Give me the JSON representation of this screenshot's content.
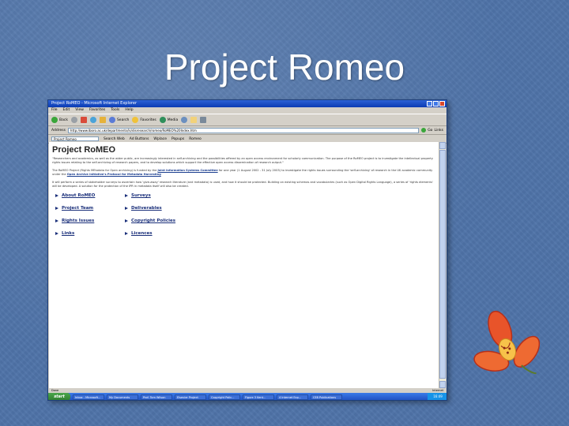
{
  "slide": {
    "title": "Project Romeo"
  },
  "browser": {
    "window_title": "Project RoMEO - Microsoft Internet Explorer",
    "menu": [
      "File",
      "Edit",
      "View",
      "Favorites",
      "Tools",
      "Help"
    ],
    "toolbar": {
      "back": "Back",
      "search": "Search",
      "favorites": "Favorites",
      "media": "Media"
    },
    "address_label": "Address",
    "address_value": "http://www.lboro.ac.uk/departments/ls/disresearch/romeo/RoMEO%20Index.htm",
    "go_label": "Go",
    "links_label": "Links",
    "search_value": "Project Romeo",
    "search_web_label": "Search Web",
    "links_bar": [
      "Ad Buttons",
      "Wplace",
      "Popups",
      "Romeo"
    ],
    "status_text": "Done",
    "status_zone": "Internet"
  },
  "page": {
    "heading": "Project RoMEO",
    "intro": "\"Researchers and academics, as well as the wider public, are increasingly interested in self-archiving and the possibilities offered by an open access environment for scholarly communication. The purpose of the RoMEO project is to investigate the intellectual property rights issues relating to the self-archiving of research papers, and to develop solutions which support the effective open access dissemination of research output.\"",
    "para1_a": "The RoMEO Project (Rights MEtadata for Open archiving) is funded by the",
    "para1_link1": "Joint Information Systems Committee",
    "para1_b": "for one year (1 August 2002 - 31 July 2003) to investigate the rights issues surrounding the 'self-archiving' of research in the UK academic community under the",
    "para1_link2": "Open Archive Initiative's Protocol for Metadata Harvesting",
    "para2": "It will perform a series of stakeholder surveys to ascertain how 'give-away' research literature (and metadata) is used, and how it should be protected. Building on existing schemas and vocabularies (such as Open Digital Rights Language), a series of 'rights elements' will be developed. A solution for the protection of the IPR in metadata itself will also be created.",
    "nav_links": [
      "About RoMEO",
      "Surveys",
      "Project Team",
      "Deliverables",
      "Rights Issues",
      "Copyright Policies",
      "Links",
      "Licences"
    ]
  },
  "taskbar": {
    "start": "start",
    "tasks": [
      "Inbox - Microsoft...",
      "My Documents",
      "Prof. Tom Wilson",
      "Elsevier Project",
      "Copyright Polic...",
      "Figure 3 Kent...",
      "4 Internet Exp...",
      "CE8 Publications"
    ],
    "clock": "16:49"
  },
  "colors": {
    "slide_bg": "#4f73a8",
    "title_text": "#ffffff",
    "link": "#1a2f7a"
  }
}
